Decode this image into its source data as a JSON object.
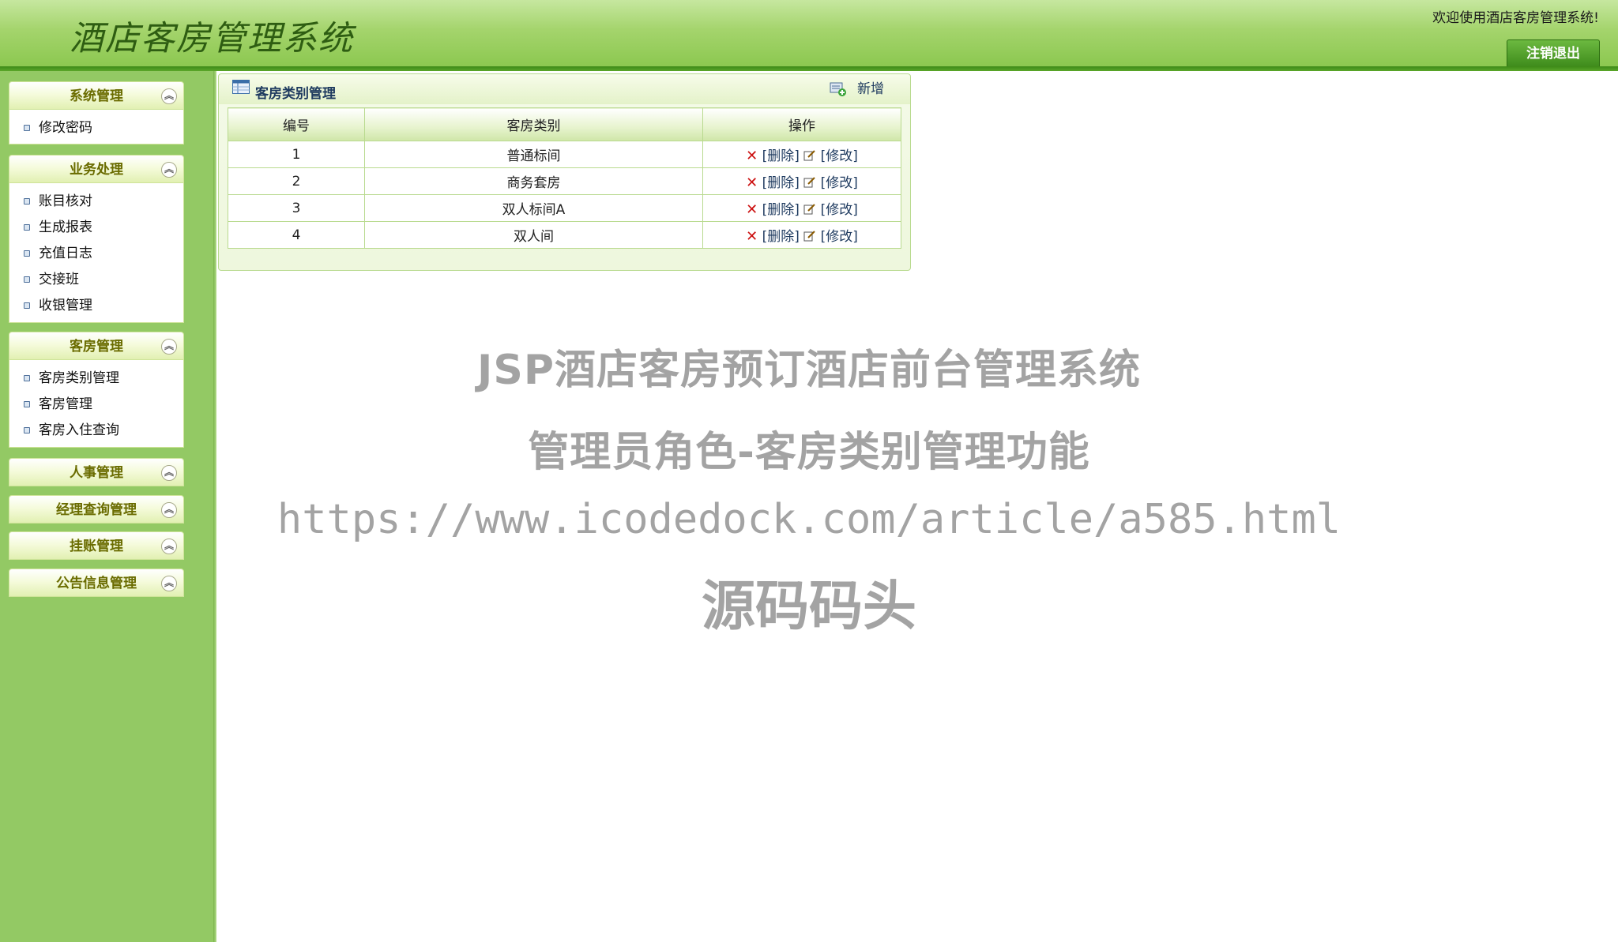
{
  "header": {
    "app_title": "酒店客房管理系统",
    "welcome": "欢迎使用酒店客房管理系统!",
    "logout_label": "注销退出"
  },
  "sidebar": {
    "groups": [
      {
        "title": "系统管理",
        "items": [
          "修改密码"
        ]
      },
      {
        "title": "业务处理",
        "items": [
          "账目核对",
          "生成报表",
          "充值日志",
          "交接班",
          "收银管理"
        ]
      },
      {
        "title": "客房管理",
        "items": [
          "客房类别管理",
          "客房管理",
          "客房入住查询"
        ]
      },
      {
        "title": "人事管理",
        "items": []
      },
      {
        "title": "经理查询管理",
        "items": []
      },
      {
        "title": "挂账管理",
        "items": []
      },
      {
        "title": "公告信息管理",
        "items": []
      }
    ],
    "collapse_glyph": "︽"
  },
  "panel": {
    "title": "客房类别管理",
    "add_label": "新增",
    "columns": [
      "编号",
      "客房类别",
      "操作"
    ],
    "rows": [
      {
        "id": "1",
        "category": "普通标间"
      },
      {
        "id": "2",
        "category": "商务套房"
      },
      {
        "id": "3",
        "category": "双人标间A"
      },
      {
        "id": "4",
        "category": "双人间"
      }
    ],
    "delete_label": "[删除]",
    "edit_label": "[修改]"
  },
  "watermark": {
    "line1": "JSP酒店客房预订酒店前台管理系统",
    "line2": "管理员角色-客房类别管理功能",
    "line3": "https://www.icodedock.com/article/a585.html",
    "line4": "源码码头"
  },
  "colors": {
    "header_green": "#8cc850",
    "sidebar_green": "#93c964",
    "menu_head_text": "#6a6c00",
    "link_blue": "#1e3a5f",
    "delete_red": "#cc1111"
  },
  "icons": {
    "collapse": "chevron-up-double-icon",
    "bullet": "square-bullet-icon",
    "table": "table-icon",
    "add": "add-record-icon",
    "delete": "delete-x-icon",
    "edit": "edit-pencil-icon"
  }
}
